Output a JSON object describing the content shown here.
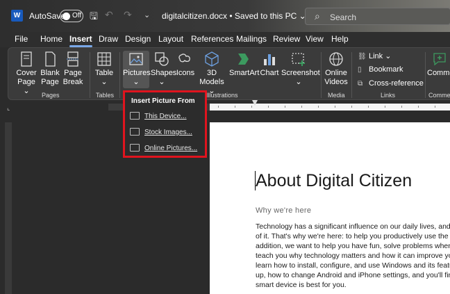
{
  "titlebar": {
    "app_letter": "W",
    "autosave_label": "AutoSave",
    "autosave_state": "Off",
    "doc_title": "digitalcitizen.docx • Saved to this PC ⌄",
    "search_placeholder": "Search"
  },
  "menu_tabs": [
    "File",
    "Home",
    "Insert",
    "Draw",
    "Design",
    "Layout",
    "References",
    "Mailings",
    "Review",
    "View",
    "Help"
  ],
  "active_tab": "Insert",
  "ribbon": {
    "pages": {
      "cover_page_1": "Cover",
      "cover_page_2": "Page ⌄",
      "blank_page_1": "Blank",
      "blank_page_2": "Page",
      "page_break_1": "Page",
      "page_break_2": "Break",
      "group": "Pages"
    },
    "tables": {
      "table": "Table",
      "table_arrow": "⌄",
      "group": "Tables"
    },
    "illustrations": {
      "pictures": "Pictures",
      "pictures_arrow": "⌄",
      "shapes": "Shapes",
      "shapes_arrow": "⌄",
      "icons": "Icons",
      "models_1": "3D",
      "models_2": "Models ⌄",
      "smartart": "SmartArt",
      "chart": "Chart",
      "screenshot": "Screenshot",
      "screenshot_arrow": "⌄",
      "group": "Illustrations"
    },
    "media": {
      "online_videos_1": "Online",
      "online_videos_2": "Videos",
      "group": "Media"
    },
    "links": {
      "link": "Link ⌄",
      "bookmark": "Bookmark",
      "cross_reference": "Cross-reference",
      "group": "Links"
    },
    "comments": {
      "comment": "Comme",
      "group": "Commen"
    }
  },
  "dropdown": {
    "title": "Insert Picture From",
    "items": [
      "This Device...",
      "Stock Images...",
      "Online Pictures..."
    ]
  },
  "document": {
    "heading": "About Digital Citizen",
    "subheading": "Why we're here",
    "body_lines": [
      "Technology has a significant influence on our daily lives, and many p",
      "of it. That's why we're here: to help you productively use the techn",
      "addition, we want to help you have fun, solve problems when they",
      "teach you why technology matters and how it can improve your life",
      "learn how to install, configure, and use Windows and its features, w",
      "up, how to change Android and iPhone settings, and you'll find it ea",
      "smart device is best for you."
    ]
  },
  "colors": {
    "accent": "#7aa8e8",
    "highlight_border": "#e0141e",
    "word_blue": "#185abd"
  }
}
